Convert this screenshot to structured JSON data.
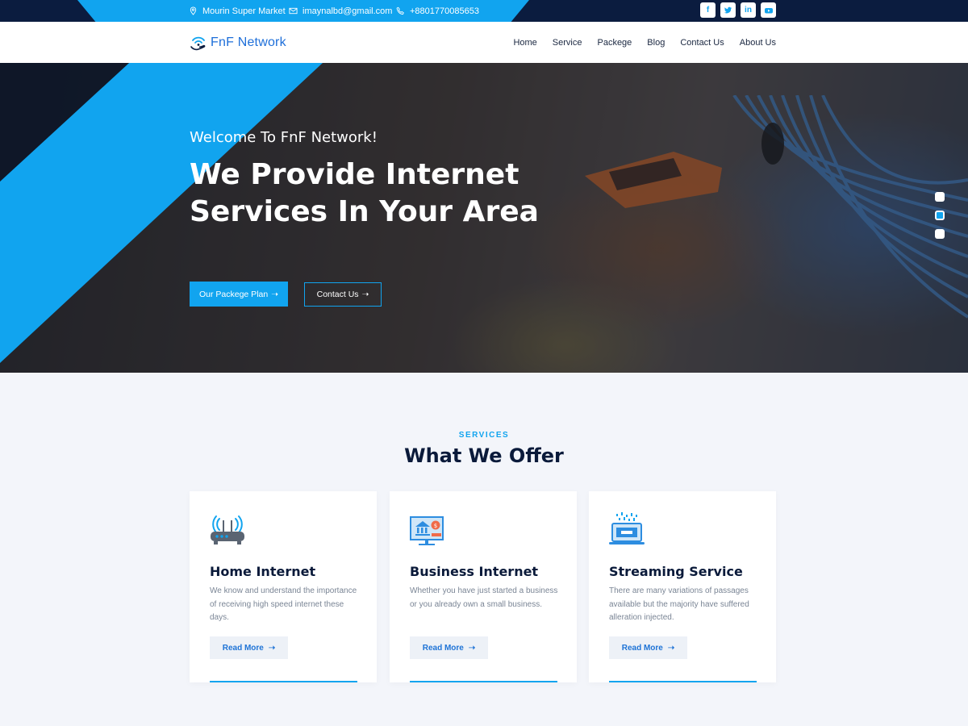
{
  "topbar": {
    "address": "Mourin Super Market",
    "email": "imaynalbd@gmail.com",
    "phone": "+8801770085653",
    "socials": [
      "facebook-icon",
      "twitter-icon",
      "linkedin-icon",
      "youtube-icon"
    ]
  },
  "nav": {
    "logo": "FnF Network",
    "items": [
      "Home",
      "Service",
      "Packege",
      "Blog",
      "Contact Us",
      "About Us"
    ]
  },
  "hero": {
    "welcome": "Welcome To FnF Network!",
    "headline": "We Provide Internet Services In Your Area",
    "primary_button": "Our Packege Plan",
    "secondary_button": "Contact Us",
    "active_slide": 2
  },
  "services": {
    "label": "SERVICES",
    "title": "What We Offer",
    "cards": [
      {
        "title": "Home Internet",
        "text": "We know and understand the importance of receiving high speed internet these days.",
        "button": "Read More",
        "icon": "router-icon"
      },
      {
        "title": "Business Internet",
        "text": "Whether you have just started a business or you already own a small business.",
        "button": "Read More",
        "icon": "business-monitor-icon"
      },
      {
        "title": "Streaming Service",
        "text": "There are many variations of passages available but the majority have suffered alleration injected.",
        "button": "Read More",
        "icon": "streaming-laptop-icon"
      }
    ]
  },
  "colors": {
    "accent": "#11a4ef",
    "dark": "#0b1c3f",
    "heading": "#0a1a3a"
  }
}
